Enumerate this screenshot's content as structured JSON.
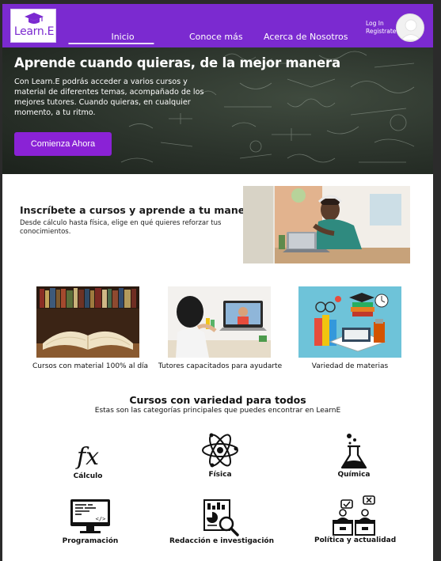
{
  "header": {
    "logo_text": "Learn.E",
    "nav": [
      {
        "label": "Inicio",
        "active": true
      },
      {
        "label": "Conoce más",
        "active": false
      },
      {
        "label": "Acerca de Nosotros",
        "active": false
      }
    ],
    "login_label": "Log In",
    "register_label": "Registrate",
    "brand_color": "#7b2ad0"
  },
  "hero": {
    "title": "Aprende cuando quieras, de la mejor manera",
    "text": "Con Learn.E podrás acceder a varios cursos y material de diferentes temas, acompañado de los mejores tutores. Cuando quieras, en cualquier momento, a tu ritmo.",
    "cta_label": "Comienza Ahora"
  },
  "intro": {
    "title": "Inscríbete a cursos y aprende a tu manera",
    "text": "Desde cálculo hasta física, elige en qué quieres reforzar tus conocimientos."
  },
  "features": [
    {
      "caption": "Cursos con material 100% al día",
      "icon": "open-book-image"
    },
    {
      "caption": "Tutores capacitados para ayudarte",
      "icon": "child-video-call-image"
    },
    {
      "caption": "Variedad de materias",
      "icon": "study-materials-image"
    }
  ],
  "categories_section": {
    "title": "Cursos con variedad para todos",
    "subtitle": "Estas son las categorías principales que puedes encontrar en LearnE",
    "items": [
      {
        "label": "Cálculo",
        "icon": "function-icon"
      },
      {
        "label": "Física",
        "icon": "atom-icon"
      },
      {
        "label": "Química",
        "icon": "flask-icon"
      },
      {
        "label": "Programación",
        "icon": "code-monitor-icon"
      },
      {
        "label": "Redacción e investigación",
        "icon": "report-search-icon"
      },
      {
        "label": "Política y actualidad",
        "icon": "debate-icon"
      }
    ]
  }
}
